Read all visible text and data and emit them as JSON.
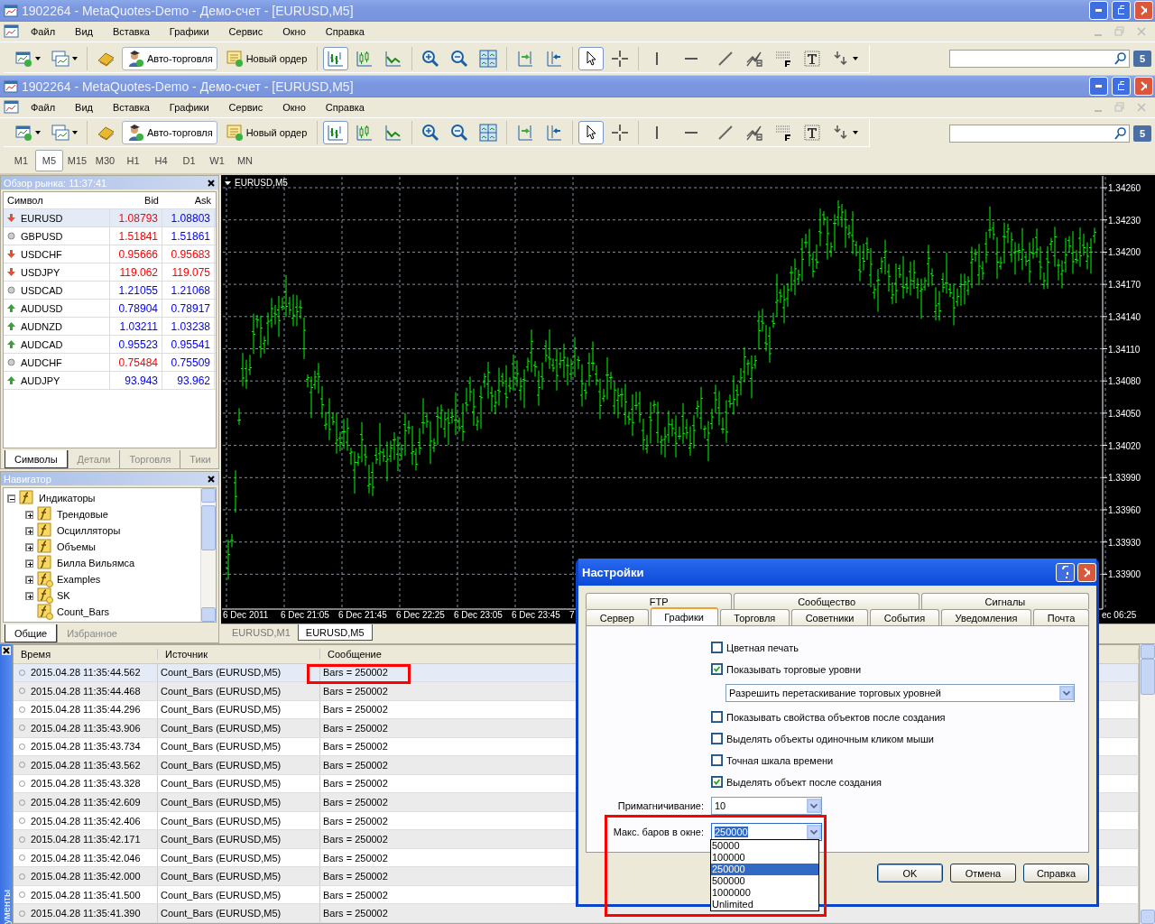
{
  "windows": [
    {
      "title": "1902264 - MetaQuotes-Demo - Демо-счет - [EURUSD,M5]",
      "menu": [
        "Файл",
        "Вид",
        "Вставка",
        "Графики",
        "Сервис",
        "Окно",
        "Справка"
      ],
      "toolbar": [
        [
          {
            "kind": "new-chart",
            "selected": false
          },
          {
            "kind": "profiles",
            "selected": false
          }
        ],
        [
          {
            "kind": "editor",
            "selected": false
          },
          {
            "kind": "autotrade",
            "label": "Авто-торговля"
          },
          {
            "kind": "new-order",
            "label": "Новый ордер"
          }
        ],
        [
          {
            "kind": "bars",
            "selected": true
          },
          {
            "kind": "candles",
            "selected": false
          },
          {
            "kind": "line",
            "selected": false
          }
        ],
        [
          {
            "kind": "zoom-in",
            "selected": false
          },
          {
            "kind": "zoom-out",
            "selected": false
          },
          {
            "kind": "tile",
            "selected": false
          }
        ],
        [
          {
            "kind": "autoscroll",
            "selected": false
          },
          {
            "kind": "shift",
            "selected": false
          }
        ],
        [
          {
            "kind": "cursor",
            "selected": true
          },
          {
            "kind": "crosshair",
            "selected": false
          }
        ],
        [
          {
            "kind": "vline",
            "selected": false
          },
          {
            "kind": "hline",
            "selected": false
          },
          {
            "kind": "trend",
            "selected": false
          },
          {
            "kind": "fibo",
            "selected": false
          },
          {
            "kind": "grid",
            "selected": false
          },
          {
            "kind": "text",
            "selected": false
          },
          {
            "kind": "arrows",
            "selected": false
          }
        ]
      ],
      "badge": "5"
    },
    {
      "title": "1902264 - MetaQuotes-Demo - Демо-счет - [EURUSD,M5]",
      "menu": [
        "Файл",
        "Вид",
        "Вставка",
        "Графики",
        "Сервис",
        "Окно",
        "Справка"
      ],
      "toolbar": [
        [
          {
            "kind": "new-chart",
            "selected": false
          },
          {
            "kind": "profiles",
            "selected": false
          }
        ],
        [
          {
            "kind": "editor",
            "selected": false
          },
          {
            "kind": "autotrade",
            "label": "Авто-торговля"
          },
          {
            "kind": "new-order",
            "label": "Новый ордер"
          }
        ],
        [
          {
            "kind": "bars",
            "selected": true
          },
          {
            "kind": "candles",
            "selected": false
          },
          {
            "kind": "line",
            "selected": false
          }
        ],
        [
          {
            "kind": "zoom-in",
            "selected": false
          },
          {
            "kind": "zoom-out",
            "selected": false
          },
          {
            "kind": "tile",
            "selected": false
          }
        ],
        [
          {
            "kind": "autoscroll",
            "selected": false
          },
          {
            "kind": "shift",
            "selected": false
          }
        ],
        [
          {
            "kind": "cursor",
            "selected": true
          },
          {
            "kind": "crosshair",
            "selected": false
          }
        ],
        [
          {
            "kind": "vline",
            "selected": false
          },
          {
            "kind": "hline",
            "selected": false
          },
          {
            "kind": "trend",
            "selected": false
          },
          {
            "kind": "fibo",
            "selected": false
          },
          {
            "kind": "grid",
            "selected": false
          },
          {
            "kind": "text",
            "selected": false
          },
          {
            "kind": "arrows",
            "selected": false
          }
        ]
      ],
      "badge": "5",
      "timeframes": [
        {
          "label": "M1",
          "selected": false
        },
        {
          "label": "M5",
          "selected": true
        },
        {
          "label": "M15",
          "selected": false
        },
        {
          "label": "M30",
          "selected": false
        },
        {
          "label": "H1",
          "selected": false
        },
        {
          "label": "H4",
          "selected": false
        },
        {
          "label": "D1",
          "selected": false
        },
        {
          "label": "W1",
          "selected": false
        },
        {
          "label": "MN",
          "selected": false
        }
      ]
    }
  ],
  "market_watch": {
    "title": "Обзор рынка: 11:37:41",
    "columns": [
      "Символ",
      "Bid",
      "Ask"
    ],
    "rows": [
      {
        "symbol": "EURUSD",
        "kind": "down",
        "bid": {
          "text": "1.08793",
          "color": "#ff0000"
        },
        "ask": {
          "text": "1.08803",
          "color": "#0000ff"
        },
        "selected": true
      },
      {
        "symbol": "GBPUSD",
        "kind": "flat",
        "bid": {
          "text": "1.51841",
          "color": "#ff0000"
        },
        "ask": {
          "text": "1.51861",
          "color": "#0000ff"
        },
        "selected": false
      },
      {
        "symbol": "USDCHF",
        "kind": "down",
        "bid": {
          "text": "0.95666",
          "color": "#ff0000"
        },
        "ask": {
          "text": "0.95683",
          "color": "#ff0000"
        },
        "selected": false
      },
      {
        "symbol": "USDJPY",
        "kind": "down",
        "bid": {
          "text": "119.062",
          "color": "#ff0000"
        },
        "ask": {
          "text": "119.075",
          "color": "#ff0000"
        },
        "selected": false
      },
      {
        "symbol": "USDCAD",
        "kind": "flat",
        "bid": {
          "text": "1.21055",
          "color": "#0000ff"
        },
        "ask": {
          "text": "1.21068",
          "color": "#0000ff"
        },
        "selected": false
      },
      {
        "symbol": "AUDUSD",
        "kind": "up",
        "bid": {
          "text": "0.78904",
          "color": "#0000ff"
        },
        "ask": {
          "text": "0.78917",
          "color": "#0000ff"
        },
        "selected": false
      },
      {
        "symbol": "AUDNZD",
        "kind": "up",
        "bid": {
          "text": "1.03211",
          "color": "#0000ff"
        },
        "ask": {
          "text": "1.03238",
          "color": "#0000ff"
        },
        "selected": false
      },
      {
        "symbol": "AUDCAD",
        "kind": "up",
        "bid": {
          "text": "0.95523",
          "color": "#0000ff"
        },
        "ask": {
          "text": "0.95541",
          "color": "#0000ff"
        },
        "selected": false
      },
      {
        "symbol": "AUDCHF",
        "kind": "flat",
        "bid": {
          "text": "0.75484",
          "color": "#ff0000"
        },
        "ask": {
          "text": "0.75509",
          "color": "#0000ff"
        },
        "selected": false
      },
      {
        "symbol": "AUDJPY",
        "kind": "up",
        "bid": {
          "text": "93.943",
          "color": "#0000ff"
        },
        "ask": {
          "text": "93.962",
          "color": "#0000ff"
        },
        "selected": false
      }
    ],
    "tabs": [
      {
        "label": "Символы",
        "selected": true
      },
      {
        "label": "Детали",
        "selected": false
      },
      {
        "label": "Торговля",
        "selected": false
      },
      {
        "label": "Тики",
        "selected": false
      }
    ]
  },
  "navigator": {
    "title": "Навигатор",
    "tree": [
      {
        "label": "Индикаторы",
        "kind": "folder",
        "expanded": true,
        "children": [
          {
            "label": "Трендовые",
            "kind": "folder",
            "expanded": false
          },
          {
            "label": "Осцилляторы",
            "kind": "folder",
            "expanded": false
          },
          {
            "label": "Объемы",
            "kind": "folder",
            "expanded": false
          },
          {
            "label": "Билла Вильямса",
            "kind": "folder",
            "expanded": false
          },
          {
            "label": "Examples",
            "kind": "custom",
            "expanded": false
          },
          {
            "label": "SK",
            "kind": "custom",
            "expanded": false
          },
          {
            "label": "Count_Bars",
            "kind": "custom"
          }
        ]
      }
    ],
    "tabs": [
      {
        "label": "Общие",
        "selected": true
      },
      {
        "label": "Избранное",
        "selected": false
      }
    ]
  },
  "chart": {
    "symbol": "EURUSD,M5",
    "price_labels": [
      "1.34260",
      "1.34230",
      "1.34200",
      "1.34170",
      "1.34140",
      "1.34110",
      "1.34080",
      "1.34050",
      "1.34020",
      "1.33990",
      "1.33960",
      "1.33930",
      "1.33900"
    ],
    "time_labels": [
      "6 Dec 2011",
      "6 Dec 21:05",
      "6 Dec 21:45",
      "6 Dec 22:25",
      "6 Dec 23:05",
      "6 Dec 23:45",
      "7",
      "ec 06:25"
    ],
    "tabs": [
      {
        "label": "EURUSD,M1",
        "selected": false
      },
      {
        "label": "EURUSD,M5",
        "selected": true
      }
    ]
  },
  "toolbox": {
    "side_tab": "ументы",
    "columns": [
      "Время",
      "Источник",
      "Сообщение"
    ],
    "rows": [
      {
        "time": "2015.04.28 11:35:44.562",
        "source": "Count_Bars (EURUSD,M5)",
        "message": "Bars = 250002",
        "selected": true
      },
      {
        "time": "2015.04.28 11:35:44.468",
        "source": "Count_Bars (EURUSD,M5)",
        "message": "Bars = 250002",
        "selected": false
      },
      {
        "time": "2015.04.28 11:35:44.296",
        "source": "Count_Bars (EURUSD,M5)",
        "message": "Bars = 250002",
        "selected": false
      },
      {
        "time": "2015.04.28 11:35:43.906",
        "source": "Count_Bars (EURUSD,M5)",
        "message": "Bars = 250002",
        "selected": false
      },
      {
        "time": "2015.04.28 11:35:43.734",
        "source": "Count_Bars (EURUSD,M5)",
        "message": "Bars = 250002",
        "selected": false
      },
      {
        "time": "2015.04.28 11:35:43.562",
        "source": "Count_Bars (EURUSD,M5)",
        "message": "Bars = 250002",
        "selected": false
      },
      {
        "time": "2015.04.28 11:35:43.328",
        "source": "Count_Bars (EURUSD,M5)",
        "message": "Bars = 250002",
        "selected": false
      },
      {
        "time": "2015.04.28 11:35:42.609",
        "source": "Count_Bars (EURUSD,M5)",
        "message": "Bars = 250002",
        "selected": false
      },
      {
        "time": "2015.04.28 11:35:42.406",
        "source": "Count_Bars (EURUSD,M5)",
        "message": "Bars = 250002",
        "selected": false
      },
      {
        "time": "2015.04.28 11:35:42.171",
        "source": "Count_Bars (EURUSD,M5)",
        "message": "Bars = 250002",
        "selected": false
      },
      {
        "time": "2015.04.28 11:35:42.046",
        "source": "Count_Bars (EURUSD,M5)",
        "message": "Bars = 250002",
        "selected": false
      },
      {
        "time": "2015.04.28 11:35:42.000",
        "source": "Count_Bars (EURUSD,M5)",
        "message": "Bars = 250002",
        "selected": false
      },
      {
        "time": "2015.04.28 11:35:41.500",
        "source": "Count_Bars (EURUSD,M5)",
        "message": "Bars = 250002",
        "selected": false
      },
      {
        "time": "2015.04.28 11:35:41.390",
        "source": "Count_Bars (EURUSD,M5)",
        "message": "Bars = 250002",
        "selected": false
      }
    ]
  },
  "dialog": {
    "title": "Настройки",
    "tab_rows": [
      [
        {
          "label": "FTP",
          "selected": false
        },
        {
          "label": "Сообщество",
          "selected": false
        },
        {
          "label": "Сигналы",
          "selected": false
        }
      ],
      [
        {
          "label": "Сервер",
          "selected": false
        },
        {
          "label": "Графики",
          "selected": true
        },
        {
          "label": "Торговля",
          "selected": false
        },
        {
          "label": "Советники",
          "selected": false
        },
        {
          "label": "События",
          "selected": false
        },
        {
          "label": "Уведомления",
          "selected": false
        },
        {
          "label": "Почта",
          "selected": false
        }
      ]
    ],
    "options": [
      {
        "kind": "checkbox",
        "label": "Цветная печать",
        "checked": false
      },
      {
        "kind": "checkbox",
        "label": "Показывать торговые уровни",
        "checked": true
      },
      {
        "kind": "select",
        "value": "Разрешить перетаскивание торговых уровней"
      },
      {
        "kind": "checkbox",
        "label": "Показывать свойства объектов после создания",
        "checked": false
      },
      {
        "kind": "checkbox",
        "label": "Выделять объекты одиночным кликом мыши",
        "checked": false
      },
      {
        "kind": "checkbox",
        "label": "Точная шкала времени",
        "checked": false
      },
      {
        "kind": "checkbox",
        "label": "Выделять объект после создания",
        "checked": true
      }
    ],
    "fields": [
      {
        "label": "Примагничивание:",
        "value": "10",
        "expanded": false
      },
      {
        "label": "Макс. баров в окне:",
        "value": "250000",
        "expanded": true,
        "options": [
          {
            "label": "50000",
            "selected": false
          },
          {
            "label": "100000",
            "selected": false
          },
          {
            "label": "250000",
            "selected": true
          },
          {
            "label": "500000",
            "selected": false
          },
          {
            "label": "1000000",
            "selected": false
          },
          {
            "label": "Unlimited",
            "selected": false
          }
        ]
      }
    ],
    "buttons": [
      "OK",
      "Отмена",
      "Справка"
    ]
  }
}
